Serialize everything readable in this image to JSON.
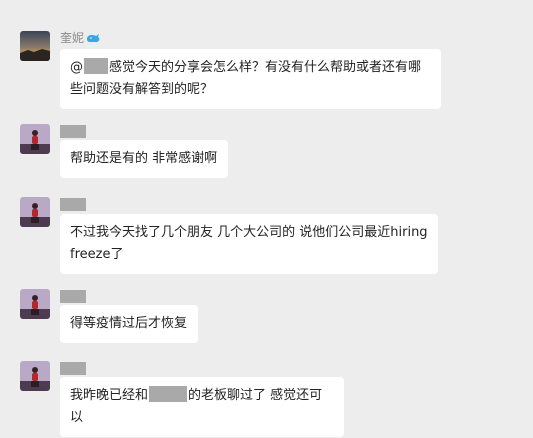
{
  "messages": [
    {
      "sender": "奎妮",
      "has_badge": true,
      "prefix": "@",
      "text": "感觉今天的分享会怎么样？有没有什么帮助或者还有哪些问题没有解答到的呢？",
      "avatar": "sunset-landscape"
    },
    {
      "sender": "",
      "text": "帮助还是有的 非常感谢啊",
      "avatar": "person-purple"
    },
    {
      "sender": "",
      "text": "不过我今天找了几个朋友 几个大公司的 说他们公司最近hiring freeze了",
      "avatar": "person-purple"
    },
    {
      "sender": "",
      "text": "得等疫情过后才恢复",
      "avatar": "person-purple"
    },
    {
      "sender": "",
      "text_before": "我昨晚已经和",
      "text_after": "的老板聊过了 感觉还可以",
      "avatar": "person-purple"
    }
  ],
  "colors": {
    "background": "#ededed",
    "bubble": "#ffffff",
    "name": "#8a8a8a",
    "redaction": "#a9a9a9",
    "badge": "#3aa8e0"
  },
  "icons": {
    "sender_badge": "whale-icon"
  }
}
